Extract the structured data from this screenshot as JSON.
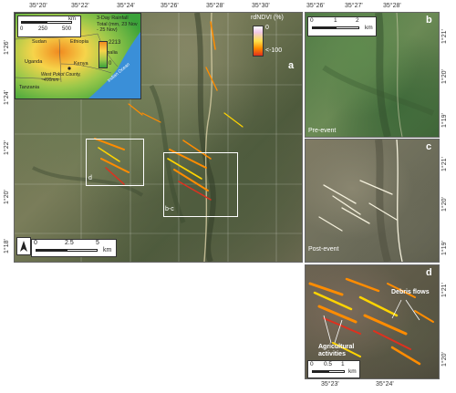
{
  "lon_labels_top": [
    "35°20'",
    "35°22'",
    "35°24'",
    "35°26'",
    "35°28'",
    "35°30'"
  ],
  "lat_labels_left": [
    "1°26'",
    "1°24'",
    "1°22'",
    "1°20'",
    "1°18'"
  ],
  "lon_labels_right_top": [
    "35°26'",
    "35°27'",
    "35°28'"
  ],
  "lat_labels_right_b": [
    "1°21'",
    "1°20'",
    "1°19'"
  ],
  "lat_labels_right_c": [
    "1°21'",
    "1°20'",
    "1°19'"
  ],
  "lat_labels_right_d": [
    "1°21'",
    "1°20'"
  ],
  "lon_labels_bottom_d": [
    "35°23'",
    "35°24'"
  ],
  "panels": {
    "a": "a",
    "b": "b",
    "c": "c",
    "d": "d"
  },
  "box_labels": {
    "d_box": "d",
    "bc_box": "b-c"
  },
  "inset": {
    "scale_unit": "km",
    "scale_ticks": [
      "0",
      "250",
      "500"
    ],
    "countries": [
      "Sudan",
      "Ethiopia",
      "Uganda",
      "Kenya",
      "Somalia",
      "Tanzania"
    ],
    "study_area": "West Pokot County, ~400mm",
    "ocean": "Indian Ocean",
    "legend_title": "3-Day Rainfall Total (mm, 23 Nov - 25 Nov)",
    "legend_max": "2213",
    "legend_min": "0"
  },
  "rdndvi_legend": {
    "title": "rdNDVI (%)",
    "top": "0",
    "bottom": "<-100"
  },
  "main_scale": {
    "ticks": [
      "0",
      "2.5",
      "5"
    ],
    "unit": "km"
  },
  "north_arrow": "N",
  "b_scale": {
    "ticks": [
      "0",
      "1",
      "2"
    ],
    "unit": "km"
  },
  "d_scale": {
    "ticks": [
      "0",
      "0.5",
      "1"
    ],
    "unit": "km"
  },
  "b_caption": "Pre-event",
  "c_caption": "Post-event",
  "d_annotations": {
    "debris": "Debris flows",
    "agri": "Agricultural activities"
  },
  "colors": {
    "debris_orange": "#ff8c00",
    "debris_yellow": "#ffd400",
    "debris_red": "#e0301e",
    "ocean": "#3a8fd8"
  }
}
